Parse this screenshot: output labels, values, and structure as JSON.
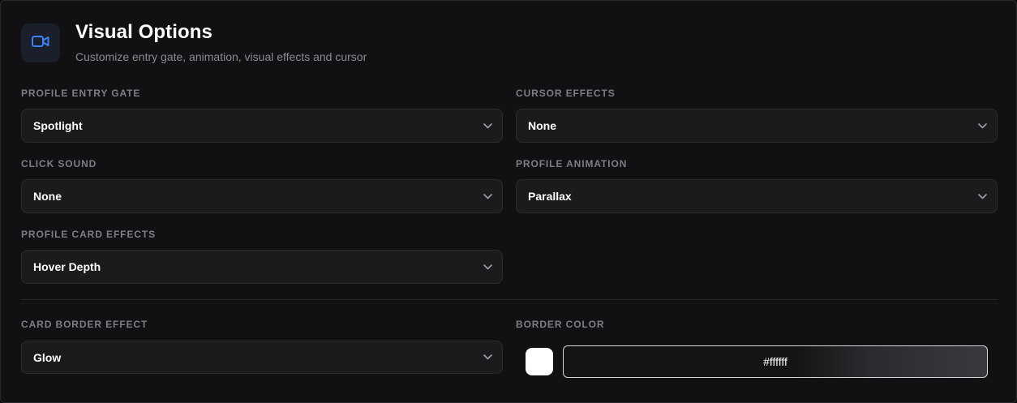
{
  "header": {
    "icon": "video-camera-icon",
    "title": "Visual Options",
    "subtitle": "Customize entry gate, animation, visual effects and cursor"
  },
  "fields": {
    "profile_entry_gate": {
      "label": "PROFILE ENTRY GATE",
      "value": "Spotlight"
    },
    "cursor_effects": {
      "label": "CURSOR EFFECTS",
      "value": "None"
    },
    "click_sound": {
      "label": "CLICK SOUND",
      "value": "None"
    },
    "profile_animation": {
      "label": "PROFILE ANIMATION",
      "value": "Parallax"
    },
    "profile_card_effects": {
      "label": "PROFILE CARD EFFECTS",
      "value": "Hover Depth"
    },
    "card_border_effect": {
      "label": "CARD BORDER EFFECT",
      "value": "Glow"
    },
    "border_color": {
      "label": "BORDER COLOR",
      "value": "#ffffff",
      "swatch": "#ffffff"
    }
  },
  "colors": {
    "accent": "#3b82f6",
    "background": "#111113",
    "field_background": "#1b1b1e"
  }
}
